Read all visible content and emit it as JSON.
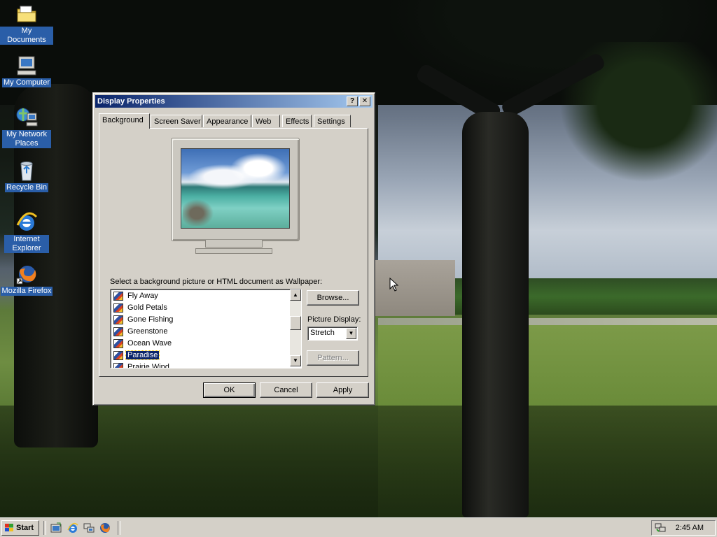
{
  "desktop_icons": [
    {
      "label": "My Documents",
      "icon": "folder-icon"
    },
    {
      "label": "My Computer",
      "icon": "computer-icon"
    },
    {
      "label": "My Network Places",
      "icon": "network-icon"
    },
    {
      "label": "Recycle Bin",
      "icon": "recycle-bin-icon"
    },
    {
      "label": "Internet Explorer",
      "icon": "ie-icon"
    },
    {
      "label": "Mozilla Firefox",
      "icon": "firefox-icon"
    }
  ],
  "dialog": {
    "title": "Display Properties",
    "help_label": "?",
    "close_label": "✕",
    "tabs": [
      {
        "label": "Background",
        "active": true
      },
      {
        "label": "Screen Saver",
        "active": false
      },
      {
        "label": "Appearance",
        "active": false
      },
      {
        "label": "Web",
        "active": false
      },
      {
        "label": "Effects",
        "active": false
      },
      {
        "label": "Settings",
        "active": false
      }
    ],
    "prompt": "Select a background picture or HTML document as Wallpaper:",
    "wallpapers": [
      {
        "name": "Fly Away",
        "selected": false
      },
      {
        "name": "Gold Petals",
        "selected": false
      },
      {
        "name": "Gone Fishing",
        "selected": false
      },
      {
        "name": "Greenstone",
        "selected": false
      },
      {
        "name": "Ocean Wave",
        "selected": false
      },
      {
        "name": "Paradise",
        "selected": true
      },
      {
        "name": "Prairie Wind",
        "selected": false
      }
    ],
    "browse_label": "Browse...",
    "picture_display_label": "Picture Display:",
    "picture_display_value": "Stretch",
    "pattern_label": "Pattern...",
    "ok_label": "OK",
    "cancel_label": "Cancel",
    "apply_label": "Apply"
  },
  "taskbar": {
    "start_label": "Start",
    "quick_launch": [
      "show-desktop-icon",
      "ie-icon",
      "network-icon",
      "firefox-icon"
    ],
    "clock": "2:45 AM"
  },
  "colors": {
    "title_active": "#0a246a",
    "selection": "#0a246a",
    "face": "#d4d0c8",
    "icon_label_bg": "#2a5ea8"
  }
}
